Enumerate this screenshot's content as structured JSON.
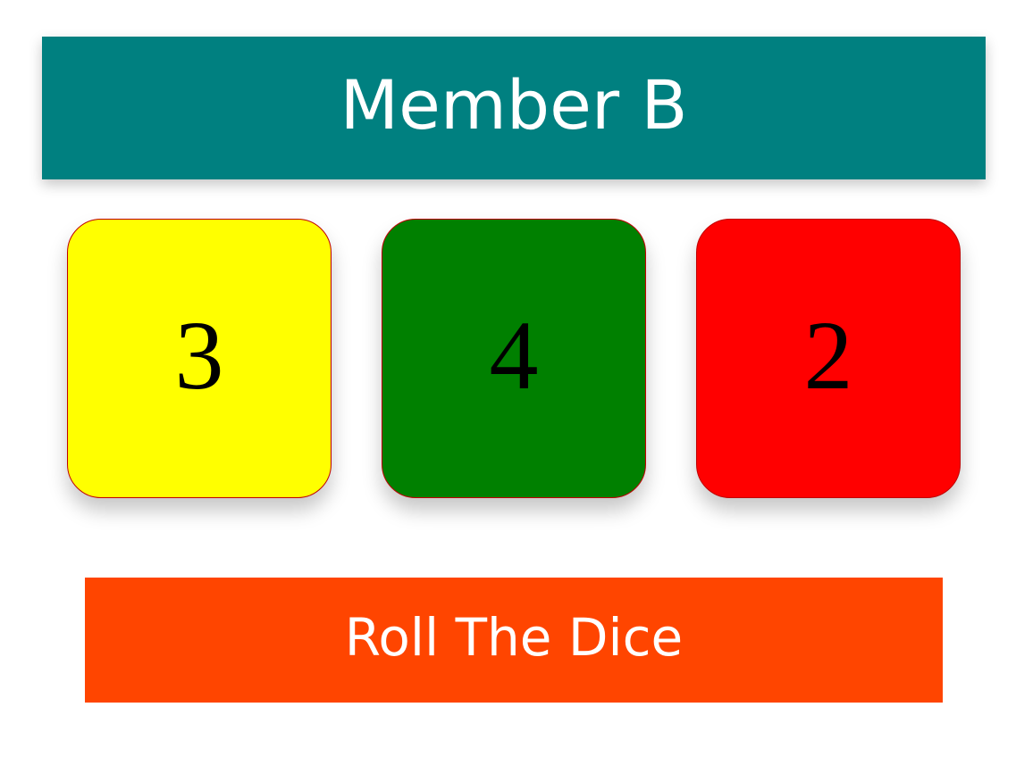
{
  "header": {
    "title": "Member B",
    "background": "#008080"
  },
  "dice": [
    {
      "value": "3",
      "color": "#ffff00"
    },
    {
      "value": "4",
      "color": "#008000"
    },
    {
      "value": "2",
      "color": "#ff0000"
    }
  ],
  "roll_button": {
    "label": "Roll The Dice",
    "background": "#ff4500"
  }
}
